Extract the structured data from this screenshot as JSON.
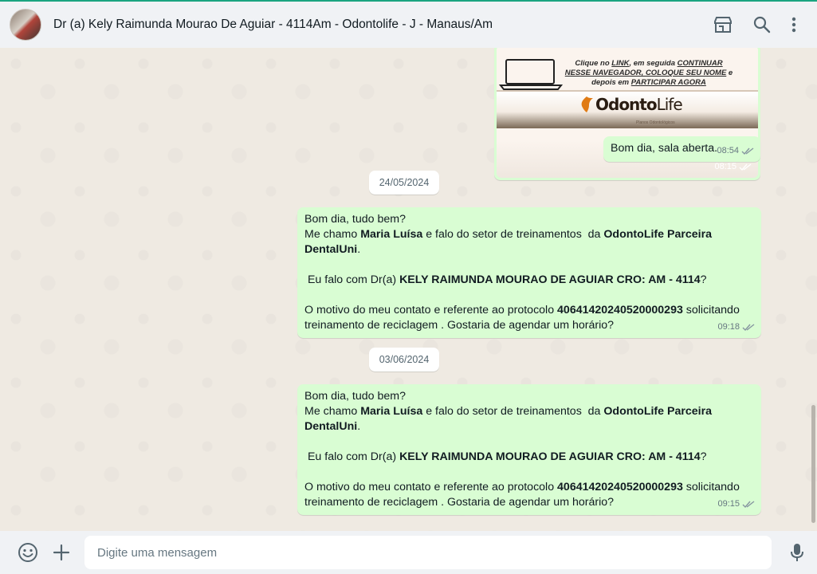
{
  "header": {
    "contact_name": "Dr (a) Kely Raimunda Mourao De Aguiar - 4114Am - Odontolife - J - Manaus/Am"
  },
  "messages": {
    "image": {
      "instruction_html": "Clique no <u>LINK</u>, em seguida <u>CONTINUAR NESSE NAVEGADOR, COLOQUE SEU NOME</u> e depois em <u>PARTICIPAR AGORA</u>",
      "logo_main": "Odonto",
      "logo_lite": "Life",
      "logo_sub": "Planos Odontológicos",
      "time": "08:15"
    },
    "room_open": {
      "text": "Bom dia, sala aberta.",
      "time": "08:54"
    },
    "dates": [
      "24/05/2024",
      "03/06/2024"
    ],
    "training_1": {
      "html": "Bom dia, tudo bem?\nMe chamo <b>Maria Luísa</b> e falo do setor de treinamentos  da <b>OdontoLife Parceira DentalUni</b>.\n\n Eu falo com Dr(a) <b>KELY RAIMUNDA MOURAO DE AGUIAR CRO: AM - 4114</b>?\n\nO motivo do meu contato e referente ao protocolo <b>40641420240520000293</b> solicitando treinamento de reciclagem . Gostaria de agendar um horário?",
      "time": "09:18"
    },
    "training_2": {
      "html": "Bom dia, tudo bem?\nMe chamo <b>Maria Luísa</b> e falo do setor de treinamentos  da <b>OdontoLife Parceira DentalUni</b>.\n\n Eu falo com Dr(a) <b>KELY RAIMUNDA MOURAO DE AGUIAR CRO: AM - 4114</b>?\n\nO motivo do meu contato e referente ao protocolo <b>40641420240520000293</b> solicitando treinamento de reciclagem . Gostaria de agendar um horário?",
      "time": "09:15"
    }
  },
  "footer": {
    "placeholder": "Digite uma mensagem"
  },
  "icons": {
    "header": [
      "catalog-icon",
      "search-icon",
      "menu-icon"
    ],
    "footer": [
      "emoji-icon",
      "attach-plus-icon",
      "microphone-icon"
    ]
  },
  "colors": {
    "accent": "#1aa480",
    "outgoing_bubble": "#d9fdd3",
    "chat_bg": "#efeae2",
    "panel_bg": "#f0f2f5"
  }
}
